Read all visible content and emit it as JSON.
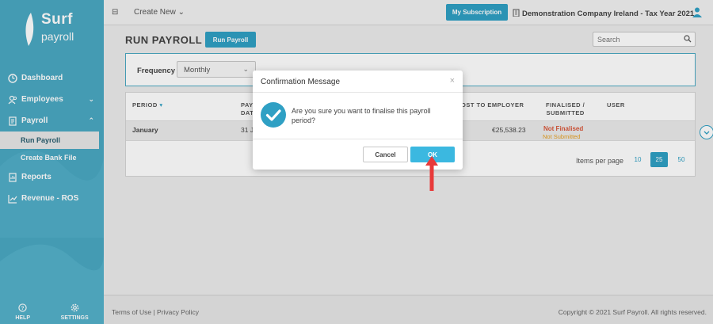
{
  "brand": {
    "name_top": "Surf",
    "name_bottom": "payroll"
  },
  "sidebar": {
    "items": [
      {
        "label": "Dashboard"
      },
      {
        "label": "Employees"
      },
      {
        "label": "Payroll"
      },
      {
        "label": "Run Payroll"
      },
      {
        "label": "Create Bank File"
      },
      {
        "label": "Reports"
      },
      {
        "label": "Revenue - ROS"
      }
    ],
    "help_label": "HELP",
    "settings_label": "SETTINGS"
  },
  "topbar": {
    "create_label": "Create New",
    "subscription_label": "My Subscription",
    "company": "Demonstration Company Ireland - Tax Year 2021"
  },
  "main": {
    "title": "RUN PAYROLL",
    "run_button": "Run Payroll",
    "search_placeholder": "Search",
    "frequency_label": "Frequency",
    "frequency_value": "Monthly",
    "table": {
      "headers": {
        "period": "PERIOD",
        "pay_date_1": "PAY",
        "pay_date_2": "DAT",
        "cost": "OST TO EMPLOYER",
        "finalised_1": "FINALISED /",
        "finalised_2": "SUBMITTED",
        "user": "USER"
      },
      "row": {
        "period": "January",
        "date": "31 Ja",
        "cost": "€25,538.23",
        "finalised": "Not Finalised",
        "submitted": "Not Submitted"
      }
    },
    "pagination": {
      "label": "Items per page",
      "options": [
        "10",
        "25",
        "50"
      ],
      "selected": "25"
    }
  },
  "footer": {
    "terms": "Terms of Use",
    "sep": "|",
    "privacy": "Privacy Policy",
    "copyright": "Copyright © 2021 Surf Payroll. All rights reserved."
  },
  "modal": {
    "title": "Confirmation Message",
    "close": "×",
    "message": "Are you sure you want to finalise this payroll period?",
    "cancel_label": "Cancel",
    "ok_label": "OK"
  },
  "colors": {
    "accent": "#2fa0c4",
    "sidebar": "#4aa9c3",
    "danger": "#d9583b",
    "warning": "#e8a020",
    "arrow": "#e83a3a"
  }
}
